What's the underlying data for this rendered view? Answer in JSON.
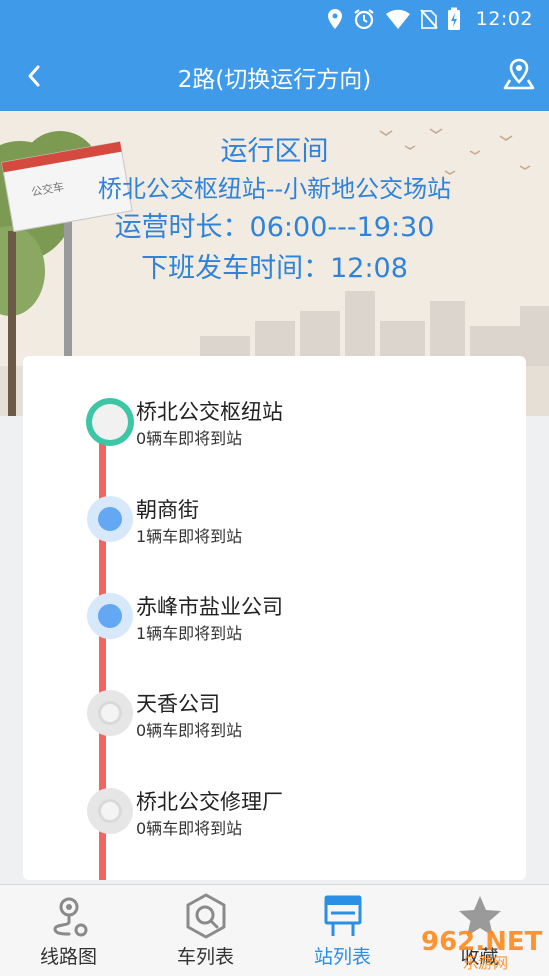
{
  "status_bar": {
    "time": "12:02",
    "icons": [
      "location-icon",
      "alarm-icon",
      "wifi-icon",
      "no-sim-icon",
      "battery-charging-icon"
    ]
  },
  "app_bar": {
    "title": "2路(切换运行方向)",
    "back_icon": "chevron-left-icon",
    "map_icon": "map-pin-icon"
  },
  "route_info": {
    "heading": "运行区间",
    "route": "桥北公交枢纽站--小新地公交场站",
    "hours": "运营时长：06:00---19:30",
    "last_departure": "下班发车时间：12:08"
  },
  "stops": [
    {
      "name": "桥北公交枢纽站",
      "status": "0辆车即将到站",
      "state": "start"
    },
    {
      "name": "朝商街",
      "status": "1辆车即将到站",
      "state": "passed"
    },
    {
      "name": "赤峰市盐业公司",
      "status": "1辆车即将到站",
      "state": "passed"
    },
    {
      "name": "天香公司",
      "status": "0辆车即将到站",
      "state": "future"
    },
    {
      "name": "桥北公交修理厂",
      "status": "0辆车即将到站",
      "state": "future"
    }
  ],
  "tabs": [
    {
      "label": "线路图",
      "icon": "route-map-icon",
      "active": false
    },
    {
      "label": "车列表",
      "icon": "bus-list-icon",
      "active": false
    },
    {
      "label": "站列表",
      "icon": "station-list-icon",
      "active": true
    },
    {
      "label": "收藏",
      "icon": "star-icon",
      "active": false
    }
  ],
  "watermark": {
    "text": "962.NET",
    "subtext": "乐游网"
  },
  "colors": {
    "primary": "#3f9ae9",
    "route_text": "#2f83d8",
    "route_line": "#f26661",
    "start_ring": "#3cc6a5",
    "passed_dot": "#64a8f3",
    "active_tab": "#2b8fe6"
  }
}
